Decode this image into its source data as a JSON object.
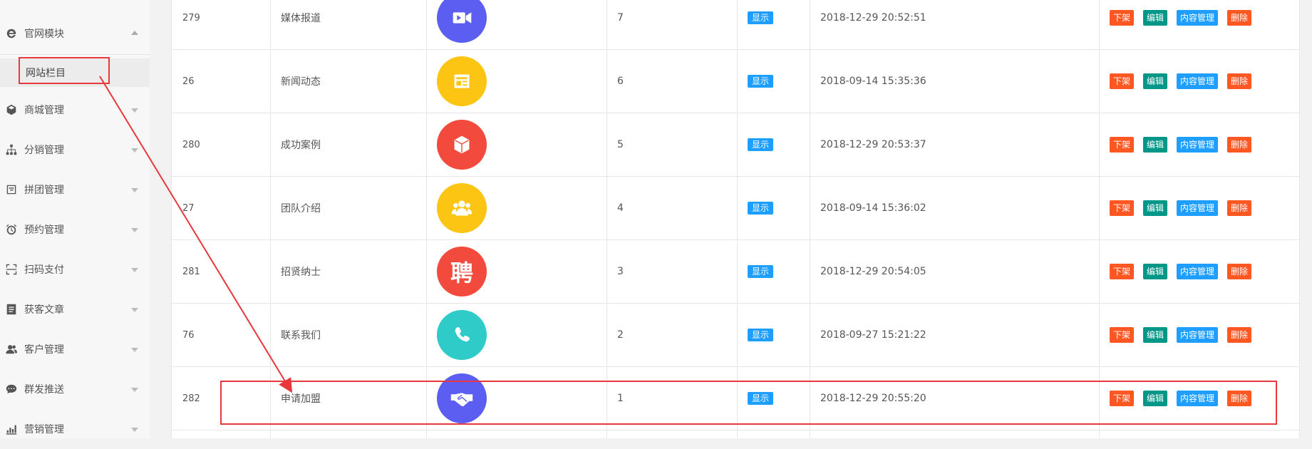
{
  "sidebar": {
    "items": [
      {
        "label": "官网模块",
        "icon": "ie-icon",
        "expanded": true
      },
      {
        "label": "商城管理",
        "icon": "cube-icon"
      },
      {
        "label": "分销管理",
        "icon": "hierarchy-icon"
      },
      {
        "label": "拼团管理",
        "icon": "group-icon"
      },
      {
        "label": "预约管理",
        "icon": "alarm-clock-icon"
      },
      {
        "label": "扫码支付",
        "icon": "scan-icon"
      },
      {
        "label": "获客文章",
        "icon": "article-icon"
      },
      {
        "label": "客户管理",
        "icon": "users-icon"
      },
      {
        "label": "群发推送",
        "icon": "chat-icon"
      },
      {
        "label": "营销管理",
        "icon": "chart-icon"
      }
    ],
    "sub_item": {
      "label": "网站栏目"
    }
  },
  "table": {
    "rows": [
      {
        "id": "279",
        "name": "媒体报道",
        "icon": "video-icon",
        "color": "#5b5ef0",
        "sort": "7",
        "status": "显示",
        "time": "2018-12-29 20:52:51"
      },
      {
        "id": "26",
        "name": "新闻动态",
        "icon": "news-icon",
        "color": "#fcc514",
        "sort": "6",
        "status": "显示",
        "time": "2018-09-14 15:35:36"
      },
      {
        "id": "280",
        "name": "成功案例",
        "icon": "box-icon",
        "color": "#f24a3c",
        "sort": "5",
        "status": "显示",
        "time": "2018-12-29 20:53:37"
      },
      {
        "id": "27",
        "name": "团队介绍",
        "icon": "team-icon",
        "color": "#fcc514",
        "sort": "4",
        "status": "显示",
        "time": "2018-09-14 15:36:02"
      },
      {
        "id": "281",
        "name": "招贤纳士",
        "icon": "recruit-icon",
        "color": "#f24a3c",
        "sort": "3",
        "status": "显示",
        "time": "2018-12-29 20:54:05",
        "glyph": "聘"
      },
      {
        "id": "76",
        "name": "联系我们",
        "icon": "phone-icon",
        "color": "#2fcbc8",
        "sort": "2",
        "status": "显示",
        "time": "2018-09-27 15:21:22"
      },
      {
        "id": "282",
        "name": "申请加盟",
        "icon": "handshake-icon",
        "color": "#5b5ef0",
        "sort": "1",
        "status": "显示",
        "time": "2018-12-29 20:55:20"
      }
    ],
    "actions": {
      "off": "下架",
      "edit": "编辑",
      "content": "内容管理",
      "delete": "删除"
    }
  },
  "colors": {
    "highlight": "#e8383d",
    "status": "#1e9fff",
    "edit": "#009688",
    "danger": "#ff5722"
  }
}
